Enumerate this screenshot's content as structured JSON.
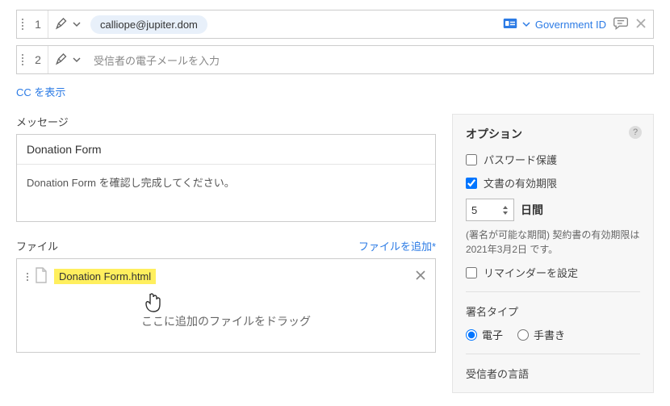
{
  "recipients": [
    {
      "num": "1",
      "email": "calliope@jupiter.dom",
      "id_label": "Government ID"
    },
    {
      "num": "2",
      "placeholder": "受信者の電子メールを入力"
    }
  ],
  "show_cc": "CC を表示",
  "message": {
    "label": "メッセージ",
    "subject": "Donation Form",
    "body": "Donation Form を確認し完成してください。"
  },
  "files": {
    "label": "ファイル",
    "add_label": "ファイルを追加*",
    "items": [
      {
        "name": "Donation Form.html"
      }
    ],
    "drop_hint": "ここに追加のファイルをドラッグ"
  },
  "options": {
    "title": "オプション",
    "password_protect": "パスワード保護",
    "doc_expiry": "文書の有効期限",
    "days_value": "5",
    "days_label": "日間",
    "hint": "(署名が可能な期間) 契約書の有効期限は 2021年3月2日 です。",
    "set_reminder": "リマインダーを設定",
    "sig_type_label": "署名タイプ",
    "sig_electronic": "電子",
    "sig_written": "手書き",
    "recipient_lang": "受信者の言語"
  }
}
